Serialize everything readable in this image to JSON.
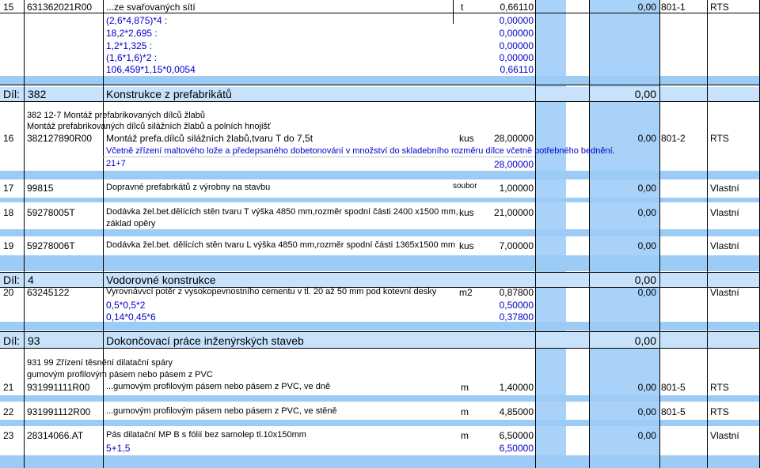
{
  "rows": [
    {
      "num": "15",
      "code": "631362021R00",
      "desc": "...ze svařovaných sítí",
      "mj": "t",
      "qty": "0,66110",
      "total": "0,00",
      "ref": "801-1",
      "src": "RTS"
    },
    {
      "num": "16",
      "code": "382127890R00",
      "desc": "Montáž prefa.dílců silážních žlabů,tvaru T do 7,5t",
      "mj": "kus",
      "qty": "28,00000",
      "total": "0,00",
      "ref": "801-2",
      "src": "RTS"
    },
    {
      "num": "17",
      "code": "99815",
      "desc": "Dopravné prefabrkátů  z výrobny na stavbu",
      "mj": "soubor",
      "qty": "1,00000",
      "total": "0,00",
      "ref": "",
      "src": "Vlastní"
    },
    {
      "num": "18",
      "code": "59278005T",
      "desc1": "Dodávka žel.bet.dělících stěn tvaru T výška 4850 mm,rozměr spodní části 2400 x1500 mm,",
      "desc2": "základ opěry",
      "mj": "kus",
      "qty": "21,00000",
      "total": "0,00",
      "ref": "",
      "src": "Vlastní"
    },
    {
      "num": "19",
      "code": "59278006T",
      "desc": "Dodávka žel.bet. dělících stěn tvaru L výška 4850 mm,rozměr spodní části 1365x1500 mm",
      "mj": "kus",
      "qty": "7,00000",
      "total": "0,00",
      "ref": "",
      "src": "Vlastní"
    },
    {
      "num": "20",
      "code": "63245122",
      "desc": "Vyrovnávvcí potěr z vysokopevnostního cementu v tl.  20 až 50 mm pod kotevní desky",
      "mj": "m2",
      "qty": "0,87800",
      "total": "0,00",
      "ref": "",
      "src": "Vlastní"
    },
    {
      "num": "21",
      "code": "931991111R00",
      "desc": "...gumovým profilovým pásem nebo pásem z PVC, ve dně",
      "mj": "m",
      "qty": "1,40000",
      "total": "0,00",
      "ref": "801-5",
      "src": "RTS"
    },
    {
      "num": "22",
      "code": "931991112R00",
      "desc": "...gumovým profilovým pásem nebo pásem z PVC, ve stěně",
      "mj": "m",
      "qty": "4,85000",
      "total": "0,00",
      "ref": "801-5",
      "src": "RTS"
    },
    {
      "num": "23",
      "code": "28314066.AT",
      "desc": "Pás dilatační MP B s fólií bez samolep tl.10x150mm",
      "mj": "m",
      "qty": "6,50000",
      "total": "0,00",
      "ref": "",
      "src": "Vlastní"
    }
  ],
  "calc15": [
    {
      "expr": "(2,6*4,875)*4 :",
      "val": "0,00000"
    },
    {
      "expr": "18,2*2,695 :",
      "val": "0,00000"
    },
    {
      "expr": "1,2*1,325 :",
      "val": "0,00000"
    },
    {
      "expr": "(1,6*1,6)*2 :",
      "val": "0,00000"
    },
    {
      "expr": "106,459*1,15*0,0054",
      "val": "0,66110"
    }
  ],
  "sections": [
    {
      "label": "Díl:",
      "code": "382",
      "title": "Konstrukce z prefabrikátů",
      "total": "0,00"
    },
    {
      "label": "Díl:",
      "code": "4",
      "title": "Vodorovné konstrukce",
      "total": "0,00"
    },
    {
      "label": "Díl:",
      "code": "93",
      "title": "Dokončovací práce inženýrských staveb",
      "total": "0,00"
    }
  ],
  "group382": {
    "line1": "382 12-7 Montáž prefabrikovaných dílců žlabů",
    "line2": "Montáž prefabrikovaných dílců silážních žlabů a polních hnojišť"
  },
  "note16": "Včetně zřízení maltového lože a předepsaného dobetonování v množství do skladebního rozměru dílce včetně potřebného bednění.",
  "calc16": {
    "expr": "21+7",
    "val": "28,00000"
  },
  "calc20": [
    {
      "expr": "0,5*0,5*2",
      "val": "0,50000"
    },
    {
      "expr": "0,14*0,45*6",
      "val": "0,37800"
    }
  ],
  "group931": {
    "line1": "931 99 Zřízení těsnění dilatační spáry",
    "line2": "gumovým profilovým pásem nebo pásem z PVC"
  },
  "calc23": {
    "expr": "5+1,5",
    "val": "6,50000"
  },
  "colors": {
    "band": "#9ccbf5",
    "column": "#a8d2f7",
    "note": "#0000cc"
  }
}
